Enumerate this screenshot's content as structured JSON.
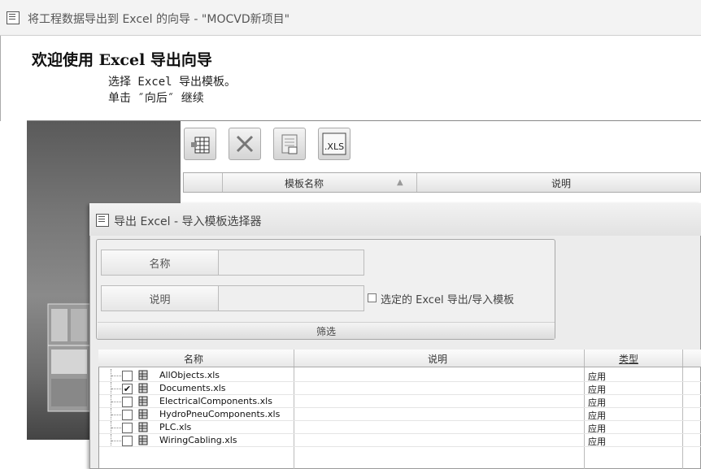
{
  "window": {
    "title": "将工程数据导出到 Excel 的向导 - \"MOCVD新项目\""
  },
  "welcome": {
    "heading": "欢迎使用 Excel 导出向导",
    "line1": "选择 Excel 导出模板。",
    "line2": "单击 ″向后″ 继续"
  },
  "toolbar": {
    "buttons": [
      {
        "icon": "new-table-icon"
      },
      {
        "icon": "delete-x-icon"
      },
      {
        "icon": "edit-document-icon"
      },
      {
        "icon": "xls-file-icon",
        "label": ".XLS"
      }
    ]
  },
  "template_list": {
    "col_name": "模板名称",
    "sort_indicator": "▲",
    "col_desc": "说明"
  },
  "dialog": {
    "title": "导出 Excel - 导入模板选择器",
    "name_label": "名称",
    "name_value": "",
    "desc_label": "说明",
    "desc_value": "",
    "checkbox_label": "选定的 Excel 导出/导入模板",
    "checkbox_checked": false,
    "filter_button": "筛选",
    "grid": {
      "headers": {
        "name": "名称",
        "desc": "说明",
        "type": "类型"
      },
      "rows": [
        {
          "checked": false,
          "name": "AllObjects.xls",
          "desc": "",
          "type": "应用"
        },
        {
          "checked": true,
          "name": "Documents.xls",
          "desc": "",
          "type": "应用"
        },
        {
          "checked": false,
          "name": "ElectricalComponents.xls",
          "desc": "",
          "type": "应用"
        },
        {
          "checked": false,
          "name": "HydroPneuComponents.xls",
          "desc": "",
          "type": "应用"
        },
        {
          "checked": false,
          "name": "PLC.xls",
          "desc": "",
          "type": "应用"
        },
        {
          "checked": false,
          "name": "WiringCabling.xls",
          "desc": "",
          "type": "应用"
        }
      ]
    }
  }
}
